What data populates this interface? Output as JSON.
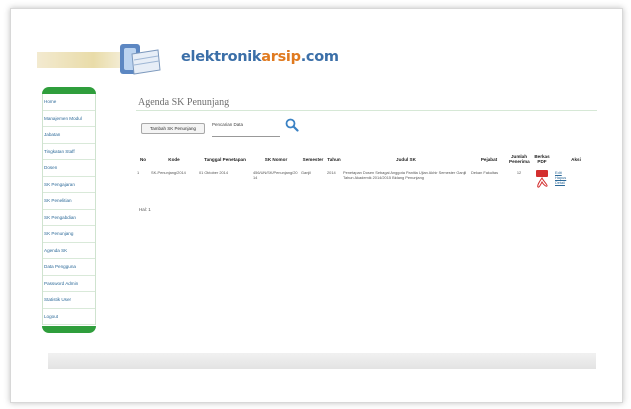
{
  "site": {
    "logo_main": "elektronik",
    "logo_accent": "arsip",
    "logo_suffix": ".com"
  },
  "sidebar": {
    "items": [
      {
        "label": "Home"
      },
      {
        "label": "Manajemen Modul"
      },
      {
        "label": "Jabatan"
      },
      {
        "label": "Tingkatan Staff"
      },
      {
        "label": "Dosen"
      },
      {
        "label": "SK Pengajaran"
      },
      {
        "label": "SK Penelitian"
      },
      {
        "label": "SK Pengabdian"
      },
      {
        "label": "SK Penunjang"
      },
      {
        "label": "Agenda SK"
      },
      {
        "label": "Data Pengguna"
      },
      {
        "label": "Password Admin"
      },
      {
        "label": "Statistik User"
      },
      {
        "label": "Logout"
      }
    ]
  },
  "main": {
    "title": "Agenda SK Penunjang",
    "add_button": "Tambah SK Penunjang",
    "search": {
      "label": "Pencarian Data",
      "value": ""
    },
    "table": {
      "columns": [
        "No",
        "Kode",
        "Tanggal Penetapan",
        "SK Nomor",
        "Semester",
        "Tahun",
        "Judul SK",
        "Pejabat",
        "Jumlah Penerima",
        "Berkas PDF",
        "Aksi"
      ],
      "rows": [
        {
          "no": "1",
          "kode": "SK-Penunjang/2014",
          "tanggal": "01 Oktober 2014",
          "nomor": "456/UN/SK/Penunjang/2014",
          "semester": "Ganjil",
          "tahun": "2014",
          "judul": "Penetapan Dosen Sebagai Anggota Panitia Ujian Akhir Semester Ganjil Tahun Akademik 2014/2015 Bidang Penunjang",
          "pejabat": "Dekan Fakultas",
          "jumlah": "12",
          "aksi_edit": "Edit",
          "aksi_hapus": "Hapus",
          "aksi_detail": "Detail"
        }
      ]
    },
    "pager": "Hal: 1"
  },
  "colors": {
    "sidebar_accent": "#2f9e3c",
    "link": "#2d6a99",
    "logo_blue": "#3b6fa8",
    "logo_orange": "#e07a1f"
  }
}
